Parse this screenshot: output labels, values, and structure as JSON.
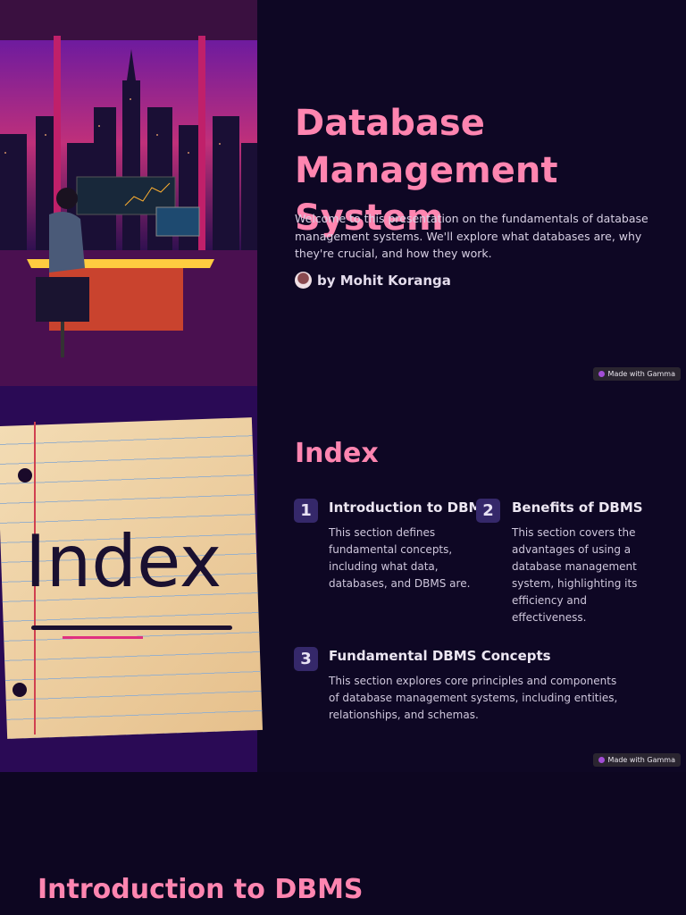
{
  "slide1": {
    "title_lines": [
      "Database",
      "Management",
      "System"
    ],
    "intro": "Welcome to this presentation on the fundamentals of database management systems. We'll explore what databases are, why they're crucial, and how they work.",
    "author": "by Mohit Koranga",
    "badge": "Made with Gamma"
  },
  "slide2": {
    "title": "Index",
    "image_text": "Index",
    "items": [
      {
        "number": "1",
        "heading": "Introduction to DBMS",
        "text": "This section defines fundamental concepts, including what data, databases, and DBMS are."
      },
      {
        "number": "2",
        "heading": "Benefits of DBMS",
        "text": "This section covers the advantages of using a database management system, highlighting its efficiency and effectiveness."
      },
      {
        "number": "3",
        "heading": "Fundamental DBMS Concepts",
        "text": "This section explores core principles and components of database management systems, including entities, relationships, and schemas."
      }
    ],
    "badge": "Made with Gamma"
  },
  "slide3": {
    "title": "Introduction to DBMS"
  }
}
